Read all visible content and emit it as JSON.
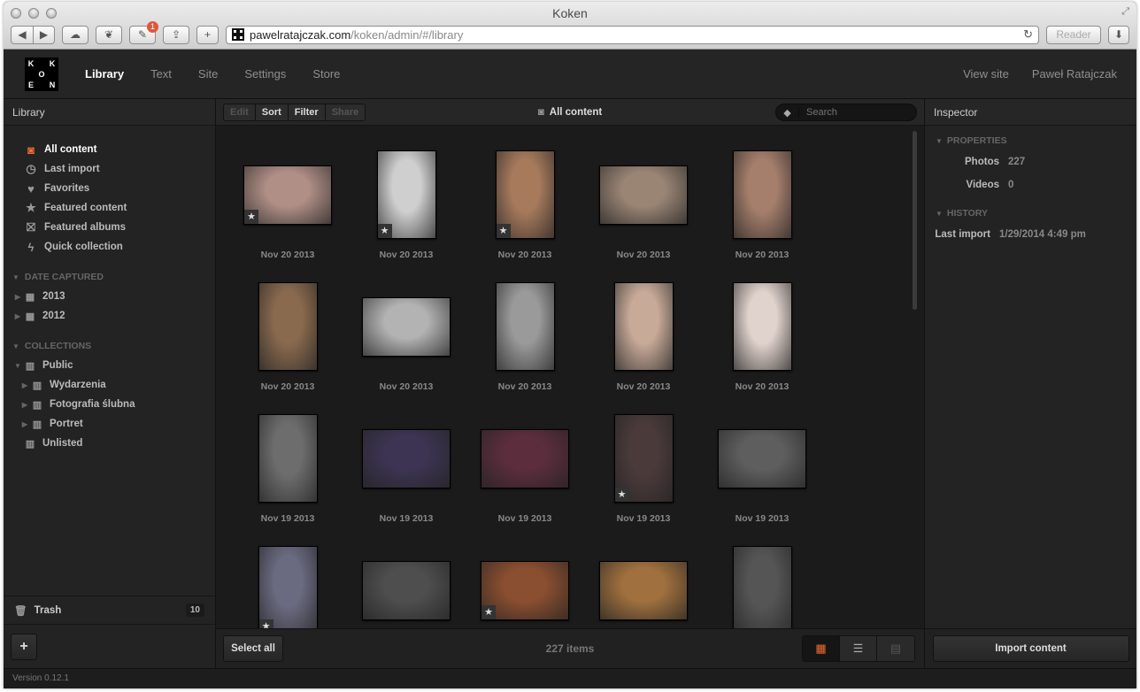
{
  "browser": {
    "window_title": "Koken",
    "notification_count": "1",
    "url_host": "pawelratajczak.com",
    "url_path": "/koken/admin/#/library",
    "reader_label": "Reader"
  },
  "app": {
    "logo_letters": [
      "K",
      "",
      "K",
      "",
      "O",
      "",
      "E",
      "",
      "N"
    ],
    "nav": [
      "Library",
      "Text",
      "Site",
      "Settings",
      "Store"
    ],
    "nav_right": [
      "View site",
      "Paweł Ratajczak"
    ]
  },
  "sidebar": {
    "title": "Library",
    "items": [
      {
        "label": "All content",
        "icon": "camera-icon"
      },
      {
        "label": "Last import",
        "icon": "clock-icon"
      },
      {
        "label": "Favorites",
        "icon": "heart-icon"
      },
      {
        "label": "Featured content",
        "icon": "star-icon"
      },
      {
        "label": "Featured albums",
        "icon": "star-album-icon"
      },
      {
        "label": "Quick collection",
        "icon": "lightning-icon"
      }
    ],
    "date_section": "DATE CAPTURED",
    "years": [
      "2013",
      "2012"
    ],
    "collections_section": "COLLECTIONS",
    "collections": {
      "public": "Public",
      "children": [
        "Wydarzenia",
        "Fotografia ślubna",
        "Portret"
      ],
      "unlisted": "Unlisted"
    },
    "trash_label": "Trash",
    "trash_count": "10",
    "add_label": "+"
  },
  "main": {
    "actions": [
      "Edit",
      "Sort",
      "Filter",
      "Share"
    ],
    "title": "All content",
    "search_placeholder": "Search",
    "select_all": "Select all",
    "items_count": "227 items",
    "photos": [
      {
        "caption": "Nov 20 2013",
        "w": 100,
        "h": 67,
        "featured": true,
        "tone": "#b08f86"
      },
      {
        "caption": "Nov 20 2013",
        "w": 67,
        "h": 100,
        "featured": true,
        "tone": "#cfcfcf"
      },
      {
        "caption": "Nov 20 2013",
        "w": 67,
        "h": 100,
        "featured": true,
        "tone": "#a77a5c"
      },
      {
        "caption": "Nov 20 2013",
        "w": 100,
        "h": 67,
        "featured": false,
        "tone": "#9a8575"
      },
      {
        "caption": "Nov 20 2013",
        "w": 67,
        "h": 100,
        "featured": false,
        "tone": "#a67f6c"
      },
      {
        "caption": "Nov 20 2013",
        "w": 67,
        "h": 100,
        "featured": false,
        "tone": "#8a6a4e"
      },
      {
        "caption": "Nov 20 2013",
        "w": 100,
        "h": 67,
        "featured": false,
        "tone": "#b3b3b3"
      },
      {
        "caption": "Nov 20 2013",
        "w": 67,
        "h": 100,
        "featured": false,
        "tone": "#9a9a9a"
      },
      {
        "caption": "Nov 20 2013",
        "w": 67,
        "h": 100,
        "featured": false,
        "tone": "#c8aa98"
      },
      {
        "caption": "Nov 20 2013",
        "w": 67,
        "h": 100,
        "featured": false,
        "tone": "#e0d2cc"
      },
      {
        "caption": "Nov 19 2013",
        "w": 67,
        "h": 100,
        "featured": false,
        "tone": "#6d6d6d"
      },
      {
        "caption": "Nov 19 2013",
        "w": 100,
        "h": 67,
        "featured": false,
        "tone": "#3c3452"
      },
      {
        "caption": "Nov 19 2013",
        "w": 100,
        "h": 67,
        "featured": false,
        "tone": "#5b2d3d"
      },
      {
        "caption": "Nov 19 2013",
        "w": 67,
        "h": 100,
        "featured": true,
        "tone": "#4a3a3a"
      },
      {
        "caption": "Nov 19 2013",
        "w": 100,
        "h": 67,
        "featured": false,
        "tone": "#5e5e5e"
      },
      {
        "caption": "",
        "w": 67,
        "h": 100,
        "featured": true,
        "tone": "#6a6a80"
      },
      {
        "caption": "",
        "w": 100,
        "h": 67,
        "featured": false,
        "tone": "#4e4e4e"
      },
      {
        "caption": "",
        "w": 100,
        "h": 67,
        "featured": true,
        "tone": "#8a4e30"
      },
      {
        "caption": "",
        "w": 100,
        "h": 67,
        "featured": false,
        "tone": "#a0703e"
      },
      {
        "caption": "",
        "w": 67,
        "h": 100,
        "featured": false,
        "tone": "#555555"
      }
    ]
  },
  "inspector": {
    "title": "Inspector",
    "properties_section": "PROPERTIES",
    "photos_label": "Photos",
    "photos_value": "227",
    "videos_label": "Videos",
    "videos_value": "0",
    "history_section": "HISTORY",
    "last_import_label": "Last import",
    "last_import_value": "1/29/2014 4:49 pm",
    "import_button": "Import content"
  },
  "status": {
    "version": "Version 0.12.1"
  },
  "colors": {
    "accent": "#f26c33",
    "background": "#1b1b1b"
  }
}
